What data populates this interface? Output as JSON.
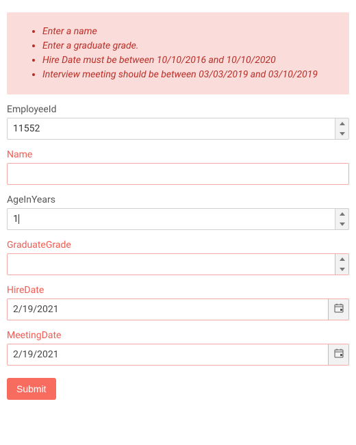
{
  "errors": {
    "items": [
      "Enter a name",
      "Enter a graduate grade.",
      "Hire Date must be between 10/10/2016 and 10/10/2020",
      "Interview meeting should be between 03/03/2019 and 03/10/2019"
    ]
  },
  "fields": {
    "employeeId": {
      "label": "EmployeeId",
      "value": "11552",
      "error": false,
      "kind": "spinner"
    },
    "name": {
      "label": "Name",
      "value": "",
      "error": true,
      "kind": "text"
    },
    "age": {
      "label": "AgeInYears",
      "value": "1",
      "error": false,
      "kind": "spinner",
      "caret": true
    },
    "grade": {
      "label": "GraduateGrade",
      "value": "",
      "error": true,
      "kind": "spinner"
    },
    "hireDate": {
      "label": "HireDate",
      "value": "2/19/2021",
      "error": true,
      "kind": "date"
    },
    "meetingDate": {
      "label": "MeetingDate",
      "value": "2/19/2021",
      "error": true,
      "kind": "date"
    }
  },
  "submit": {
    "label": "Submit"
  },
  "colors": {
    "error": "#f05c53",
    "errbox_bg": "#fadcda",
    "errbox_text": "#ba2d26",
    "accent": "#f86c60"
  }
}
